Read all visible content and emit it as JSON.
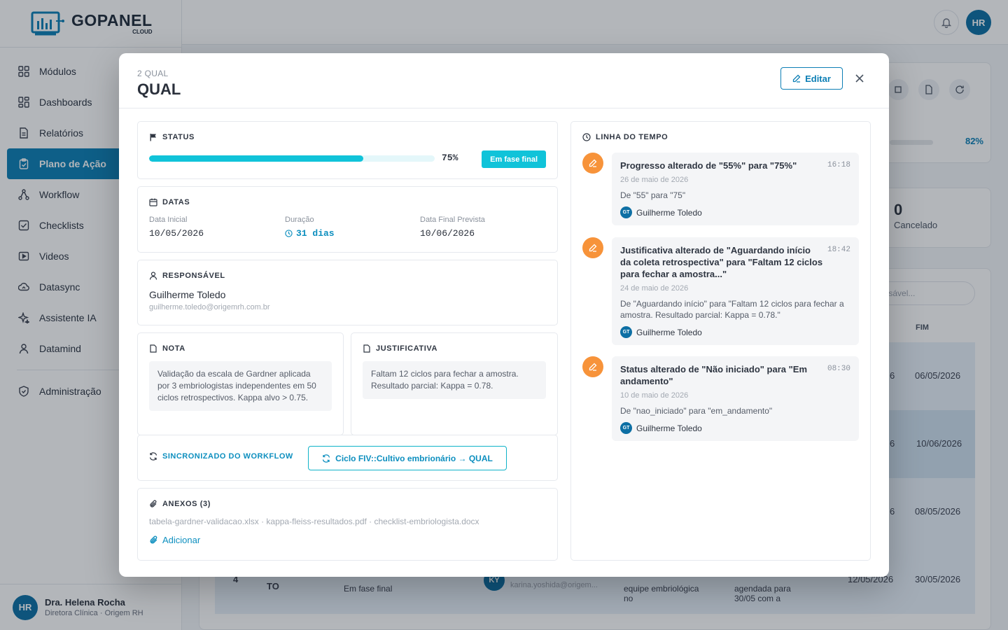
{
  "app": {
    "logo_main": "GOPANEL",
    "logo_sub": "CLOUD",
    "nav": [
      {
        "label": "Módulos",
        "icon": "grid-icon"
      },
      {
        "label": "Dashboards",
        "icon": "dashboard-icon"
      },
      {
        "label": "Relatórios",
        "icon": "report-icon"
      },
      {
        "label": "Plano de Ação",
        "icon": "clipboard-check-icon",
        "active": true
      },
      {
        "label": "Workflow",
        "icon": "workflow-icon"
      },
      {
        "label": "Checklists",
        "icon": "checkbox-icon"
      },
      {
        "label": "Videos",
        "icon": "play-icon"
      },
      {
        "label": "Datasync",
        "icon": "cloud-sync-icon"
      },
      {
        "label": "Assistente IA",
        "icon": "sparkle-icon"
      },
      {
        "label": "Datamind",
        "icon": "user-mind-icon"
      }
    ],
    "admin_label": "Administração",
    "user": {
      "initials": "HR",
      "name": "Dra. Helena Rocha",
      "role": "Diretora Clínica · Origem RH"
    },
    "top_avatar": "HR"
  },
  "background": {
    "progress_pct": "82%",
    "cancel_count": "0",
    "cancel_label": "Cancelado",
    "search_placeholder": "onsável...",
    "col_end": "FIM",
    "end_dates": [
      "06/05/2026",
      "10/06/2026",
      "08/05/2026",
      "30/05/2026"
    ],
    "partial_starts": [
      "6",
      "6",
      "6"
    ],
    "last_row": {
      "num": "4",
      "code": "TO",
      "status": "Em fase final",
      "owner_initials": "KY",
      "owner_mail": "karina.yoshida@origem...",
      "text1": "equipe embriológica no",
      "text2": "agendada para 30/05 com a",
      "start": "12/05/2026"
    }
  },
  "modal": {
    "kicker": "2 QUAL",
    "title": "QUAL",
    "edit_label": "Editar",
    "status": {
      "label": "STATUS",
      "progress": 0.75,
      "pct_text": "75%",
      "badge": "Em fase final",
      "badge_color": "#10c3d9"
    },
    "dates": {
      "label": "DATAS",
      "start_label": "Data Inicial",
      "start": "10/05/2026",
      "duration_label": "Duração",
      "duration": "31 dias",
      "end_label": "Data Final Prevista",
      "end": "10/06/2026"
    },
    "responsible": {
      "label": "RESPONSÁVEL",
      "name": "Guilherme Toledo",
      "email": "guilherme.toledo@origemrh.com.br"
    },
    "note": {
      "label": "NOTA",
      "text": "Validação da escala de Gardner aplicada por 3 embriologistas independentes em 50 ciclos retrospectivos. Kappa alvo > 0.75."
    },
    "justification": {
      "label": "JUSTIFICATIVA",
      "text": "Faltam 12 ciclos para fechar a amostra. Resultado parcial: Kappa = 0.78."
    },
    "sync": {
      "label": "SINCRONIZADO DO WORKFLOW",
      "button": "Ciclo FIV::Cultivo embrionário → QUAL"
    },
    "attachments": {
      "label": "ANEXOS (3)",
      "files": "tabela-gardner-validacao.xlsx · kappa-fleiss-resultados.pdf · checklist-embriologista.docx",
      "add": "Adicionar"
    },
    "timeline": {
      "label": "LINHA DO TEMPO",
      "items": [
        {
          "title": "Progresso alterado de \"55%\" para \"75%\"",
          "time": "16:18",
          "date": "26 de maio de 2026",
          "desc": "De \"55\" para \"75\"",
          "user_initials": "GT",
          "user": "Guilherme Toledo"
        },
        {
          "title": "Justificativa alterado de \"Aguardando início da coleta retrospectiva\" para \"Faltam 12 ciclos para fechar a amostra...\"",
          "time": "18:42",
          "date": "24 de maio de 2026",
          "desc": "De \"Aguardando início\" para \"Faltam 12 ciclos para fechar a amostra. Resultado parcial: Kappa = 0.78.\"",
          "user_initials": "GT",
          "user": "Guilherme Toledo"
        },
        {
          "title": "Status alterado de \"Não iniciado\" para \"Em andamento\"",
          "time": "08:30",
          "date": "10 de maio de 2026",
          "desc": "De \"nao_iniciado\" para \"em_andamento\"",
          "user_initials": "GT",
          "user": "Guilherme Toledo"
        }
      ]
    }
  }
}
